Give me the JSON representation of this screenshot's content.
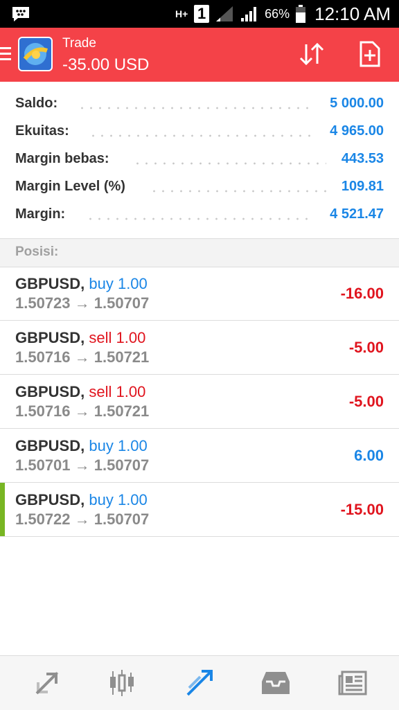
{
  "status_bar": {
    "network": "H+",
    "sim_slot": "1",
    "battery": "66%",
    "time": "12:10 AM",
    "icons": [
      "bbm-message-icon",
      "signal-1-icon",
      "signal-2-icon",
      "battery-icon"
    ]
  },
  "app_bar": {
    "title": "Trade",
    "subtitle": "-35.00 USD",
    "color": "#f44248",
    "icons": [
      "menu-icon",
      "metatrader-logo",
      "sort-icon",
      "new-order-icon"
    ]
  },
  "summary": [
    {
      "label": "Saldo:",
      "value": "5 000.00"
    },
    {
      "label": "Ekuitas:",
      "value": "4 965.00"
    },
    {
      "label": "Margin bebas:",
      "value": "443.53"
    },
    {
      "label": "Margin Level (%)",
      "value": "109.81"
    },
    {
      "label": "Margin:",
      "value": "4 521.47"
    }
  ],
  "section_title": "Posisi:",
  "positions": [
    {
      "symbol": "GBPUSD",
      "sep": ",",
      "type": "buy 1.00",
      "prices": "1.50723 → 1.50707",
      "profit": "-16.00"
    },
    {
      "symbol": "GBPUSD",
      "sep": ",",
      "type": "sell 1.00",
      "prices": "1.50716 → 1.50721",
      "profit": "-5.00"
    },
    {
      "symbol": "GBPUSD",
      "sep": ",",
      "type": "sell 1.00",
      "prices": "1.50716 → 1.50721",
      "profit": "-5.00"
    },
    {
      "symbol": "GBPUSD",
      "sep": ",",
      "type": "buy 1.00",
      "prices": "1.50701 → 1.50707",
      "profit": "6.00"
    },
    {
      "symbol": "GBPUSD",
      "sep": ",",
      "type": "buy 1.00",
      "prices": "1.50722 → 1.50707",
      "profit": "-15.00"
    }
  ],
  "bottom_nav": {
    "items": [
      "quotes-icon",
      "chart-icon",
      "trade-icon",
      "history-icon",
      "news-icon"
    ],
    "active": "trade-icon",
    "active_color": "#1a86e6",
    "inactive_color": "#8f8f8f"
  },
  "colors": {
    "accent": "#1a86e6",
    "loss": "#e0141e",
    "marker": "#78b623"
  }
}
